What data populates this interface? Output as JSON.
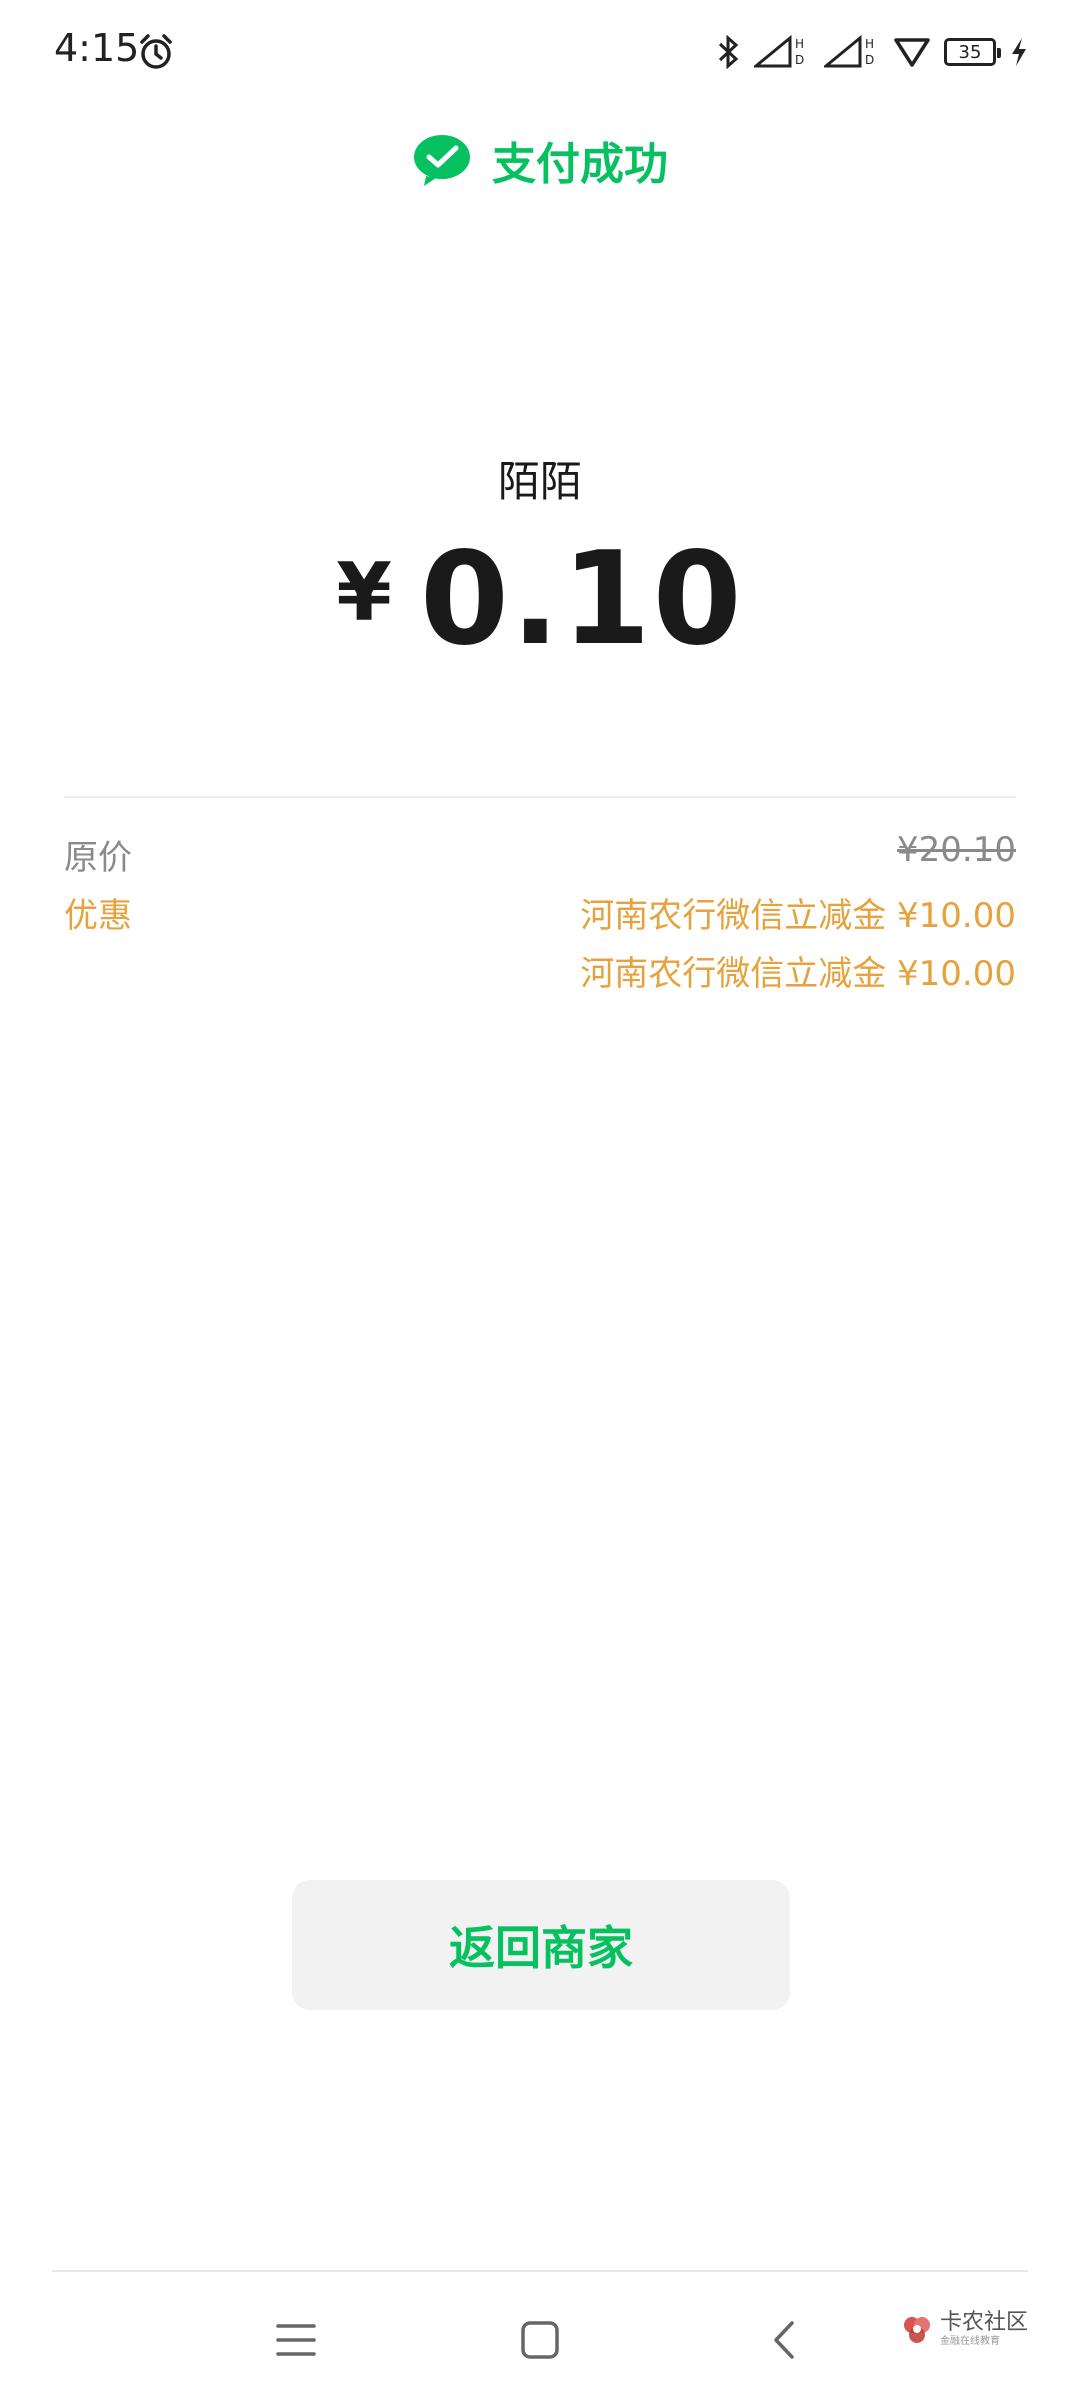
{
  "status_bar": {
    "time": "4:15",
    "battery": "35",
    "icons": [
      "alarm-icon",
      "bluetooth-icon",
      "signal-hd-icon",
      "signal-hd-icon",
      "wifi-icon",
      "battery-icon",
      "charging-icon"
    ]
  },
  "header": {
    "title": "支付成功",
    "icon": "wechat-pay-check-icon",
    "accent": "#07c160"
  },
  "payment": {
    "merchant": "陌陌",
    "currency": "¥",
    "amount": "0.10"
  },
  "details": {
    "original_label": "原价",
    "original_value": "¥20.10",
    "discount_label": "优惠",
    "discounts": [
      "河南农行微信立减金 ¥10.00",
      "河南农行微信立减金 ¥10.00"
    ],
    "discount_color": "#e6a23c"
  },
  "actions": {
    "return_label": "返回商家"
  },
  "nav_bar": {
    "icons": [
      "menu-icon",
      "home-icon",
      "back-icon"
    ]
  },
  "watermark": {
    "main": "卡农社区",
    "sub": "金融在线教育"
  }
}
